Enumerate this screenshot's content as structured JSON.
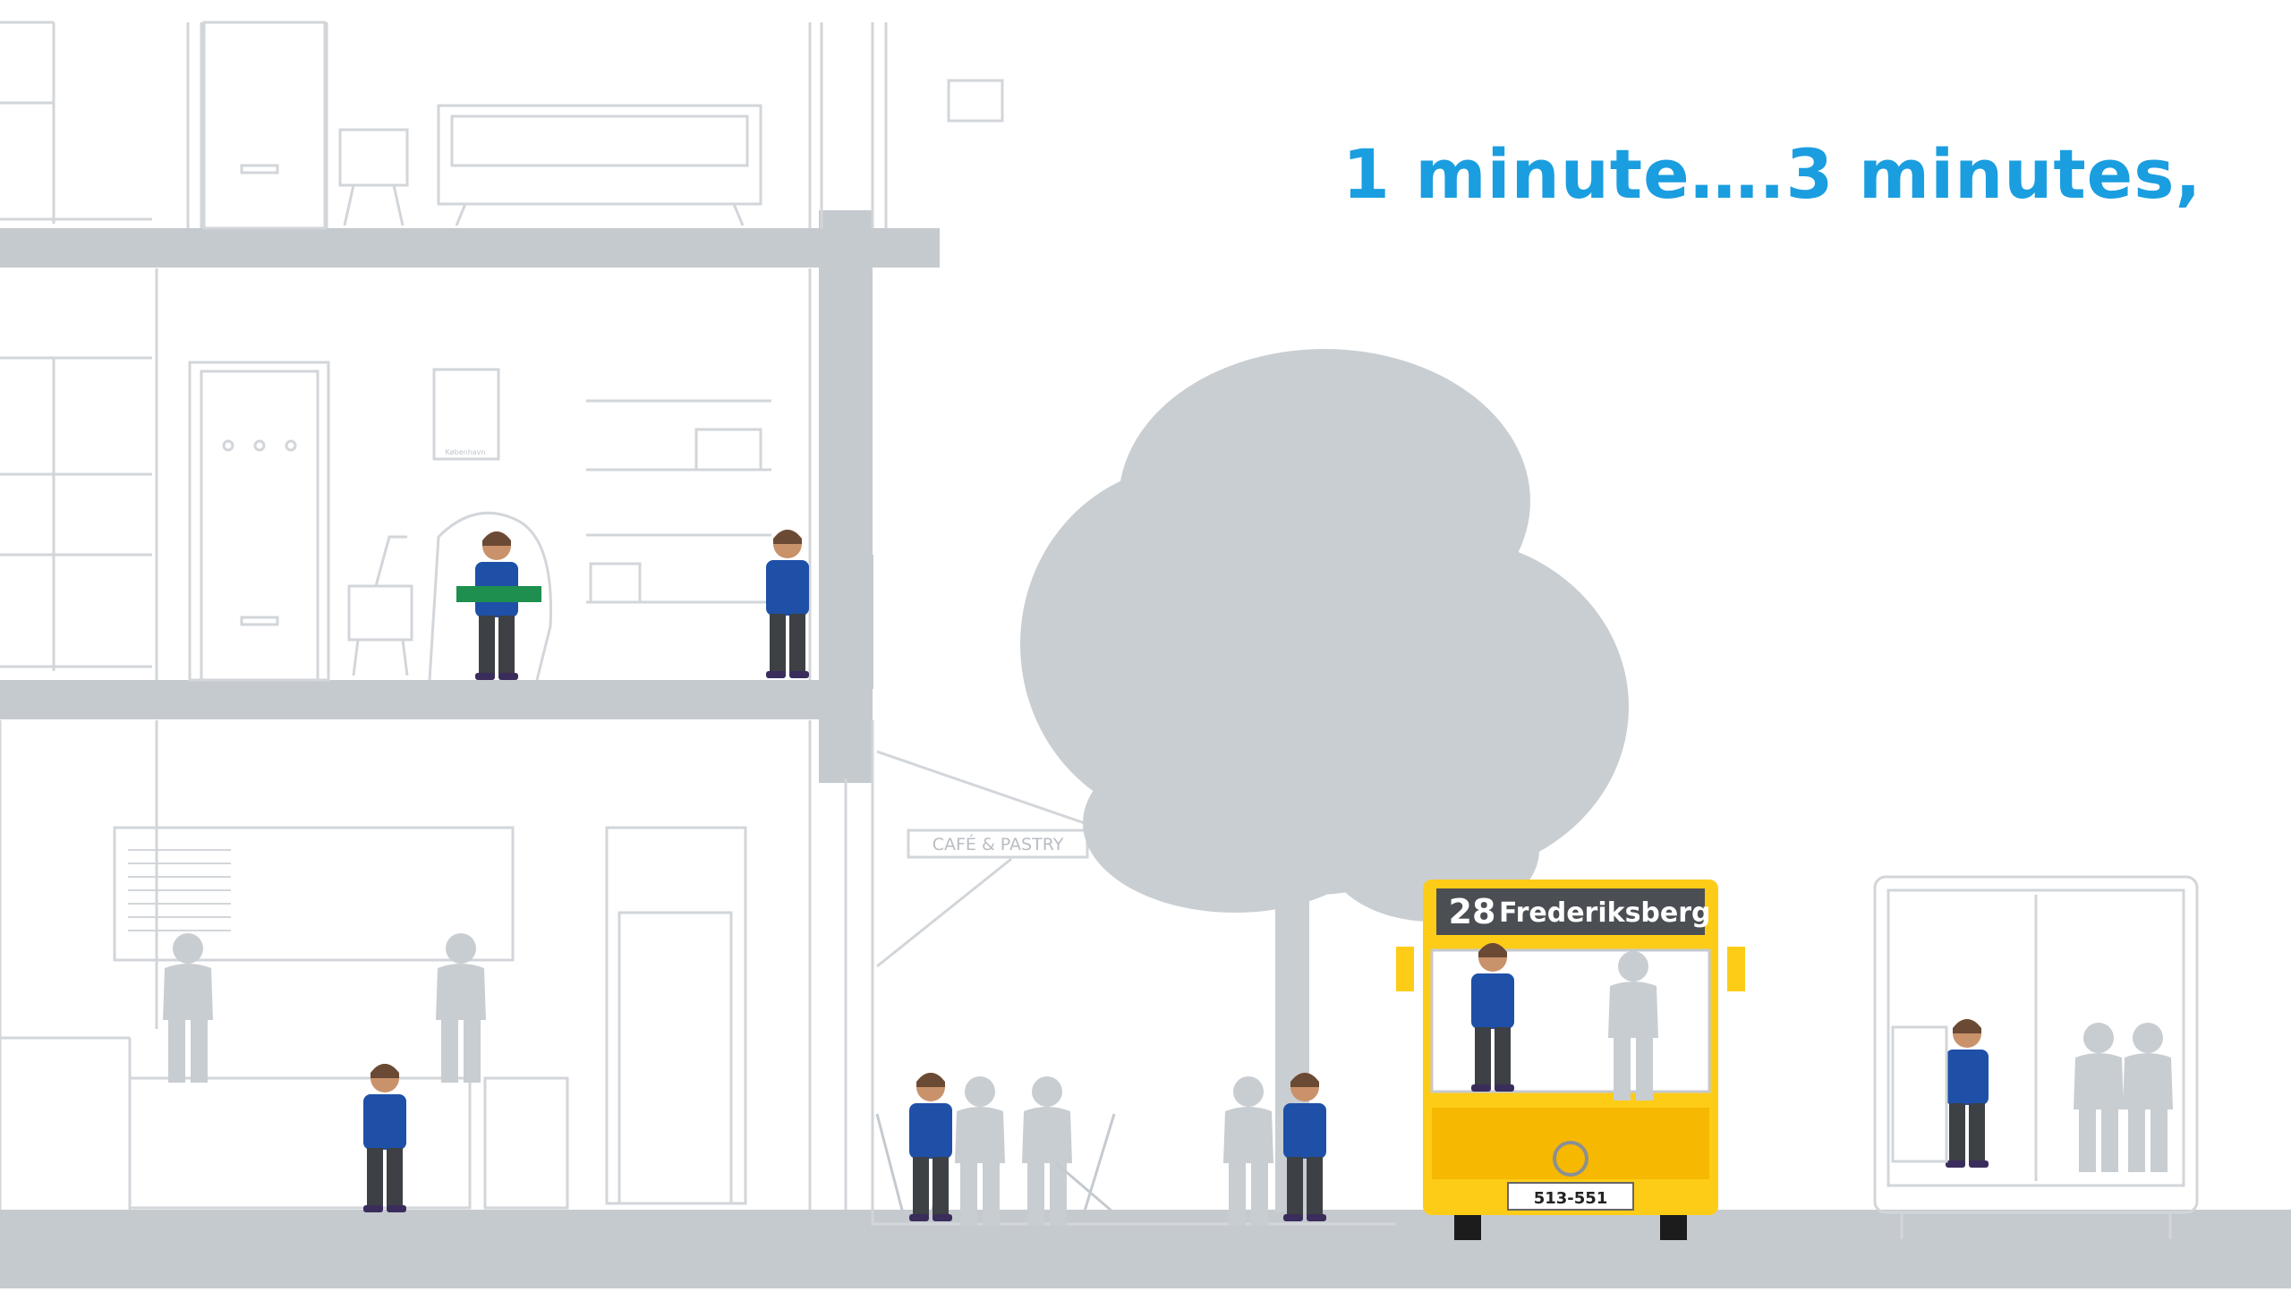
{
  "caption": "1 minute….3 minutes,",
  "cafe_sign": "CAFÉ & PASTRY",
  "bus": {
    "route_number": "28",
    "destination": "Frederiksberg",
    "plate": "513-551"
  },
  "poster_caption": "København",
  "colors": {
    "caption": "#1a9ee0",
    "structure": "#c5cacf",
    "line": "#d2d6da",
    "tree": "#c9ced2",
    "shirt": "#1f50a8",
    "bus_yellow": "#fdcc17",
    "sign_bg": "#4b4f54"
  }
}
